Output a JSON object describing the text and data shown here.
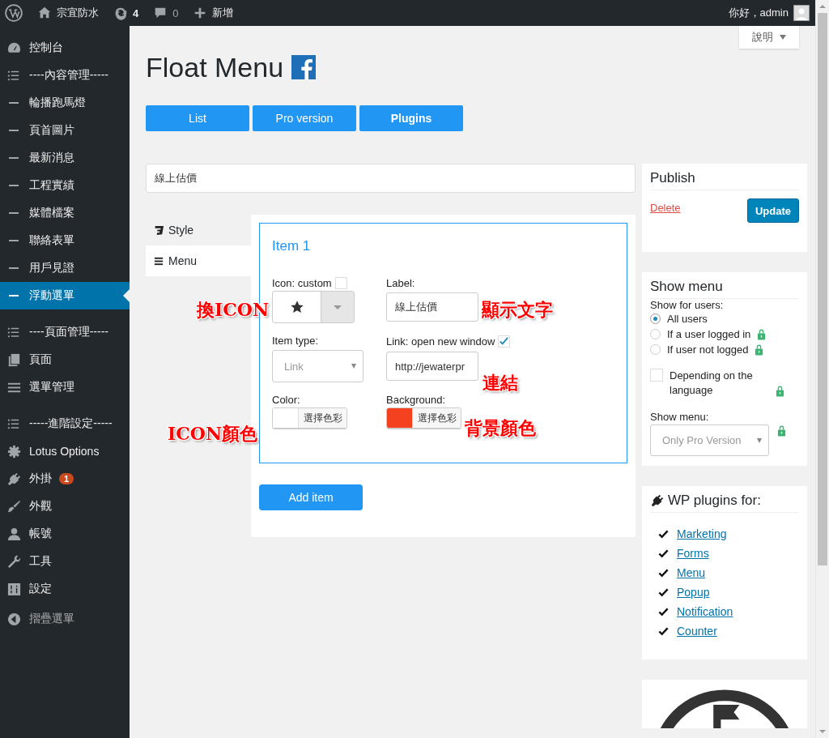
{
  "top_bar": {
    "site_name": "宗宜防水",
    "updates": "4",
    "comments": "0",
    "new_label": "新增",
    "greeting": "你好，admin"
  },
  "help_tab": {
    "label": "說明"
  },
  "sidebar": {
    "sections": [
      [
        {
          "label": "控制台",
          "selected": false
        },
        {
          "label": "----內容管理-----",
          "selected": false
        },
        {
          "label": "輪播跑馬燈",
          "selected": false
        },
        {
          "label": "頁首圖片",
          "selected": false
        },
        {
          "label": "最新消息",
          "selected": false
        },
        {
          "label": "工程實績",
          "selected": false
        },
        {
          "label": "媒體檔案",
          "selected": false
        },
        {
          "label": "聯絡表單",
          "selected": false
        },
        {
          "label": "用戶見證",
          "selected": false
        },
        {
          "label": "浮動選單",
          "selected": true
        }
      ],
      [
        {
          "label": "----頁面管理-----",
          "selected": false
        },
        {
          "label": "頁面",
          "selected": false
        },
        {
          "label": "選單管理",
          "selected": false
        }
      ],
      [
        {
          "label": "-----進階設定-----",
          "selected": false
        },
        {
          "label": "Lotus Options",
          "selected": false
        },
        {
          "label": "外掛",
          "selected": false,
          "badge": "1"
        },
        {
          "label": "外觀",
          "selected": false
        },
        {
          "label": "帳號",
          "selected": false
        },
        {
          "label": "工具",
          "selected": false
        },
        {
          "label": "設定",
          "selected": false
        }
      ]
    ],
    "collapse_label": "摺疊選單"
  },
  "page": {
    "title": "Float Menu",
    "buttons": [
      {
        "label": "List",
        "bold": false
      },
      {
        "label": "Pro version",
        "bold": false
      },
      {
        "label": "Plugins",
        "bold": true
      }
    ],
    "menu_name": "線上估價"
  },
  "editor_tabs": [
    {
      "label": "Style",
      "selected": false
    },
    {
      "label": "Menu",
      "selected": true
    }
  ],
  "item": {
    "title": "Item 1",
    "icon_label": "Icon: custom",
    "icon_custom": false,
    "label_label": "Label:",
    "label_value": "線上估價",
    "type_label": "Item type:",
    "type_value": "Link",
    "link_label": "Link: open new window",
    "link_new_window": true,
    "link_value": "http://jewaterpr",
    "color_fields": [
      {
        "label": "Color:",
        "button": "選擇色彩",
        "color": "#ffffff"
      },
      {
        "label": "Background:",
        "button": "選擇色彩",
        "color": "#f4411f"
      }
    ]
  },
  "add_item": "Add item",
  "annotations": [
    "換ICON",
    "顯示文字",
    "連結",
    "ICON顏色",
    "背景顏色"
  ],
  "publish": {
    "title": "Publish",
    "delete": "Delete",
    "update": "Update"
  },
  "show_menu": {
    "title": "Show menu",
    "users_label": "Show for users:",
    "options": [
      {
        "label": "All users",
        "selected": true,
        "locked": false
      },
      {
        "label": "If a user logged in",
        "selected": false,
        "locked": true
      },
      {
        "label": "If user not logged",
        "selected": false,
        "locked": true
      }
    ],
    "language": {
      "label": "Depending on the language",
      "checked": false,
      "locked": true
    },
    "show_label": "Show menu:",
    "show_value": "Only Pro Version",
    "show_locked": true
  },
  "plugins": {
    "title": "WP plugins for:",
    "links": [
      "Marketing",
      "Forms",
      "Menu",
      "Popup",
      "Notification",
      "Counter"
    ]
  }
}
